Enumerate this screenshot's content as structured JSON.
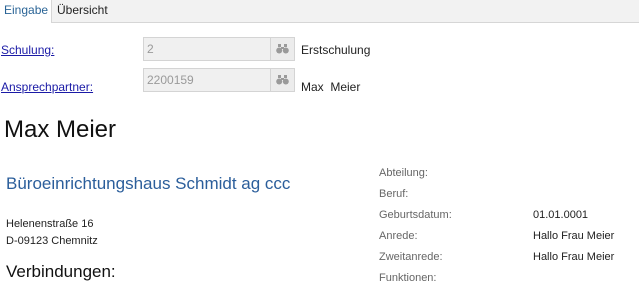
{
  "tabs": [
    {
      "label": "Eingabe",
      "active": true
    },
    {
      "label": "Übersicht",
      "active": false
    }
  ],
  "fields": {
    "schulung": {
      "label": "Schulung:",
      "value": "2",
      "description": "Erstschulung"
    },
    "ansprechpartner": {
      "label": "Ansprechpartner:",
      "value": "2200159",
      "description": "Max  Meier"
    }
  },
  "person": {
    "name": "Max Meier"
  },
  "company": {
    "name": "Büroeinrichtungshaus Schmidt ag ccc",
    "street": "Helenenstraße 16",
    "city": "D-09123 Chemnitz"
  },
  "connections_heading": "Verbindungen:",
  "info": [
    {
      "label": "Abteilung:",
      "value": ""
    },
    {
      "label": "Beruf:",
      "value": ""
    },
    {
      "label": "Geburtsdatum:",
      "value": "01.01.0001"
    },
    {
      "label": "Anrede:",
      "value": "Hallo Frau Meier"
    },
    {
      "label": "Zweitanrede:",
      "value": "Hallo Frau Meier"
    },
    {
      "label": "Funktionen:",
      "value": ""
    }
  ],
  "icons": {
    "lookup": "binoculars-icon"
  },
  "colors": {
    "link": "#1a1aa6",
    "accent": "#2b5e9b",
    "tab_active": "#2a6496"
  }
}
